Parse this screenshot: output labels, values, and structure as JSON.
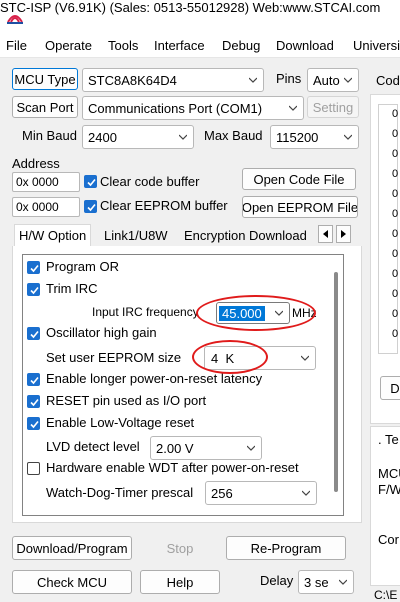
{
  "window": {
    "title": "STC-ISP (V6.91K) (Sales: 0513-55012928) Web:www.STCAI.com"
  },
  "menu": [
    "File",
    "Operate",
    "Tools",
    "Interface",
    "Debug",
    "Download",
    "Universi"
  ],
  "mcu": {
    "type_button": "MCU Type",
    "type_value": "STC8A8K64D4",
    "pins_label": "Pins",
    "pins_value": "Auto"
  },
  "port": {
    "scan_button": "Scan Port",
    "value": "Communications Port (COM1)",
    "setting_button": "Setting"
  },
  "baud": {
    "min_label": "Min Baud",
    "min_value": "2400",
    "max_label": "Max Baud",
    "max_value": "115200"
  },
  "address": {
    "label": "Address",
    "code_value": "0x 0000",
    "clear_code_label": "Clear code buffer",
    "open_code_button": "Open Code File",
    "eeprom_value": "0x 0000",
    "clear_eeprom_label": "Clear EEPROM buffer",
    "open_eeprom_button": "Open EEPROM File"
  },
  "tabs": [
    "H/W Option",
    "Link1/U8W",
    "Encryption Download"
  ],
  "options": {
    "program_or": "Program OR",
    "trim_irc": "Trim IRC",
    "irc_freq_label": "Input IRC frequency",
    "irc_freq_value": "45.000",
    "irc_freq_unit": "MHz",
    "osc_high_gain": "Oscillator high gain",
    "eeprom_size_label": "Set user EEPROM size",
    "eeprom_size_value": "4  K",
    "longer_reset": "Enable longer power-on-reset latency",
    "reset_pin_io": "RESET pin used as I/O port",
    "low_voltage_reset": "Enable Low-Voltage reset",
    "lvd_label": "LVD detect level",
    "lvd_value": "2.00 V",
    "hw_wdt": "Hardware enable WDT after power-on-reset",
    "wdt_prescal_label": "Watch-Dog-Timer prescal",
    "wdt_prescal_value": "256"
  },
  "actions": {
    "download": "Download/Program",
    "stop": "Stop",
    "reprogram": "Re-Program",
    "check_mcu": "Check MCU",
    "help": "Help",
    "delay_label": "Delay",
    "delay_value": "3 se"
  },
  "right": {
    "code_header": "Cod",
    "col_marker": "0",
    "d_button": "D",
    "te_label": ". Te",
    "mcu_label": "MCU",
    "fw_label": "F/W",
    "con_label": "Cor",
    "bottom_label": "C:\\E"
  },
  "colors": {
    "accent": "#0078d7",
    "checkbox": "#1a6fcf",
    "highlight_circle": "#e01b1b",
    "selected_field": "#0078d7"
  }
}
